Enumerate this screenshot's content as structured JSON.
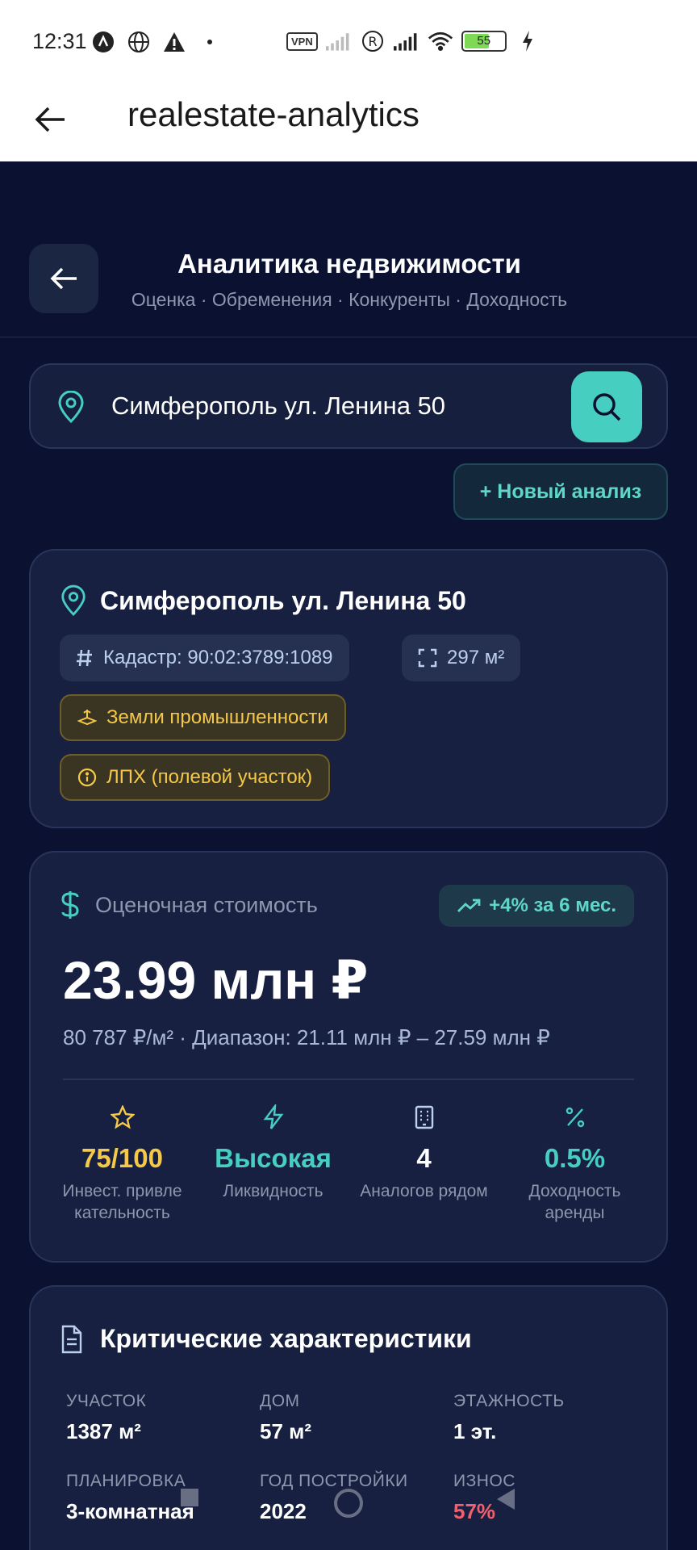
{
  "status_bar": {
    "time": "12:31",
    "vpn": "VPN",
    "battery": "55"
  },
  "app_bar": {
    "title": "realestate-analytics"
  },
  "header": {
    "title": "Аналитика недвижимости",
    "subtitle": "Оценка · Обременения · Конкуренты · Доходность"
  },
  "search": {
    "value": "Симферополь ул. Ленина 50"
  },
  "new_analysis_label": "+ Новый анализ",
  "property": {
    "address": "Симферополь ул. Ленина 50",
    "cadastre": "Кадастр: 90:02:3789:1089",
    "area": "297 м²",
    "land_category": "Земли промышленности",
    "usage": "ЛПХ (полевой участок)"
  },
  "valuation": {
    "heading": "Оценочная стоимость",
    "trend": "+4% за 6 мес.",
    "price": "23.99 млн ₽",
    "sub": "80 787 ₽/м² · Диапазон: 21.11 млн ₽ – 27.59 млн ₽",
    "metrics": [
      {
        "value": "75/100",
        "label": "Инвест. привле кательность",
        "color": "#f5c84a",
        "icon": "star-icon"
      },
      {
        "value": "Высокая",
        "label": "Ликвидность",
        "color": "#46cfc0",
        "icon": "lightning-icon"
      },
      {
        "value": "4",
        "label": "Аналогов рядом",
        "color": "#ffffff",
        "icon": "building-icon"
      },
      {
        "value": "0.5%",
        "label": "Доходность аренды",
        "color": "#46cfc0",
        "icon": "percent-icon"
      }
    ]
  },
  "critical": {
    "heading": "Критические характеристики",
    "items": [
      {
        "label": "УЧАСТОК",
        "value": "1387 м²"
      },
      {
        "label": "ДОМ",
        "value": "57 м²"
      },
      {
        "label": "ЭТАЖНОСТЬ",
        "value": "1 эт."
      },
      {
        "label": "ПЛАНИРОВКА",
        "value": "3-комнатная"
      },
      {
        "label": "ГОД ПОСТРОЙКИ",
        "value": "2022"
      },
      {
        "label": "ИЗНОС",
        "value": "57%"
      }
    ]
  },
  "colors": {
    "accent": "#46cfc0",
    "warning": "#f5c84a",
    "danger": "#f0606f",
    "background": "#0b1130",
    "card": "#172040"
  }
}
